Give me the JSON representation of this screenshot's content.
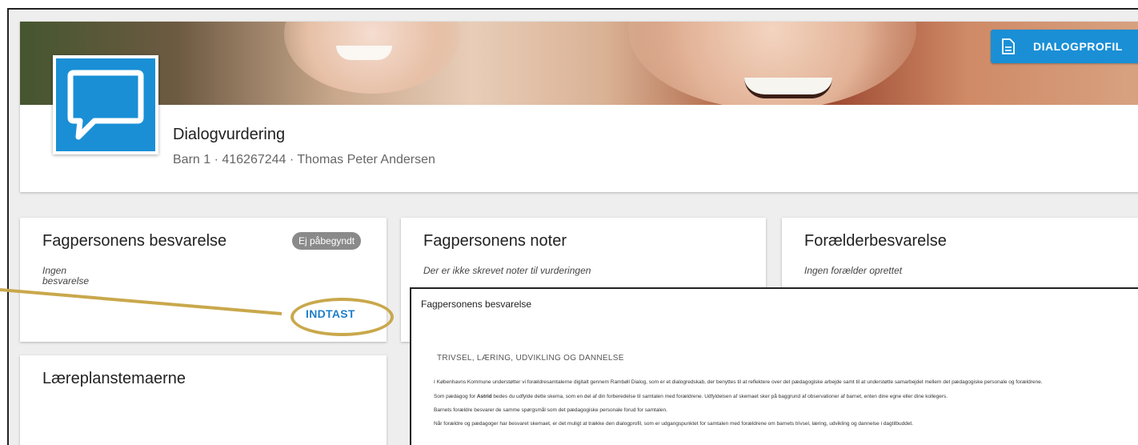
{
  "header": {
    "title": "Dialogvurdering",
    "subtitle": "Barn 1 · 416267244 · Thomas Peter Andersen",
    "dialogprofil_label": "DIALOGPROFIL"
  },
  "cards": {
    "fagperson_besvarelse": {
      "title": "Fagpersonens besvarelse",
      "badge": "Ej påbegyndt",
      "note_line1": "Ingen",
      "note_line2": "besvarelse",
      "button": "INDTAST"
    },
    "fagperson_noter": {
      "title": "Fagpersonens noter",
      "note": "Der er ikke skrevet noter til vurderingen"
    },
    "foraelder": {
      "title": "Forælderbesvarelse",
      "note": "Ingen forælder oprettet"
    },
    "laereplan": {
      "title": "Læreplanstemaerne"
    }
  },
  "overlay": {
    "title": "Fagpersonens besvarelse",
    "section": "TRIVSEL, LÆRING, UDVIKLING OG DANNELSE",
    "p1": "I Københavns Kommune understøtter vi forældresamtalerne digitalt gennem Rambøll Dialog, som er et dialogredskab, der benyttes til at reflektere over det pædagogiske arbejde samt til at understøtte samarbejdet mellem det pædagogiske personale og forældrene.",
    "p2_before": "Som pædagog for ",
    "p2_name": "Astrid",
    "p2_after": " bedes du udfylde dette skema, som en del af din forberedelse til samtalen med forældrene. Udfyldelsen af skemaet sker på baggrund af observationer af barnet, enten dine egne eller dine kollegers.",
    "p3": "Barnets forældre besvarer de samme spørgsmål som det pædagogiske personale forud for samtalen.",
    "p4": "Når forældre og pædagoger har besvaret skemaet, er det muligt at trække den dialogprofil, som er udgangspunktet for samtalen med forældrene om barnets trivsel, læring, udvikling og dannelse i dagtilbuddet."
  },
  "colors": {
    "accent": "#1a8fd6",
    "highlight": "#c9a84c",
    "badge": "#8a8a8a"
  }
}
